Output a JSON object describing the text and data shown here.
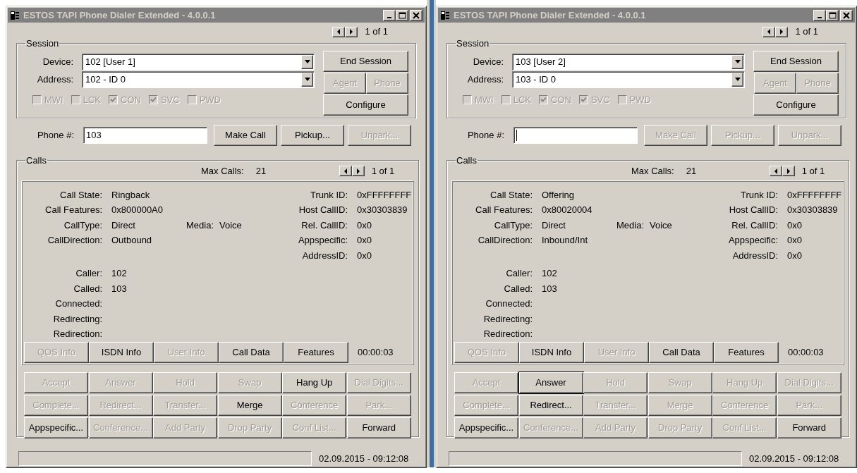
{
  "windows": [
    {
      "title": "ESTOS TAPI Phone Dialer Extended - 4.0.0.1",
      "active": false,
      "pager": "1 of 1",
      "session": {
        "legend": "Session",
        "device": {
          "label": "Device:",
          "value": "102 [User 1]"
        },
        "address": {
          "label": "Address:",
          "value": "102 - ID 0"
        },
        "flags": [
          {
            "label": "MWI",
            "checked": false
          },
          {
            "label": "LCK",
            "checked": false
          },
          {
            "label": "CON",
            "checked": true
          },
          {
            "label": "SVC",
            "checked": true
          },
          {
            "label": "PWD",
            "checked": false
          }
        ],
        "buttons": [
          {
            "label": "End Session",
            "kind": "wide",
            "disabled": false
          },
          {
            "label": "Agent",
            "kind": "half",
            "disabled": true
          },
          {
            "label": "Phone",
            "kind": "half",
            "disabled": true
          },
          {
            "label": "Configure",
            "kind": "wide",
            "disabled": false
          }
        ]
      },
      "phone": {
        "label": "Phone #:",
        "value": "103",
        "focused": false,
        "buttons": [
          {
            "label": "Make Call",
            "disabled": false
          },
          {
            "label": "Pickup...",
            "disabled": false
          },
          {
            "label": "Unpark...",
            "disabled": true
          }
        ]
      },
      "calls": {
        "legend": "Calls",
        "max_label": "Max Calls:",
        "max_value": "21",
        "pager": "1 of 1",
        "fields": [
          {
            "label": "Call State:",
            "value": "Ringback"
          },
          {
            "label": "Call Features:",
            "value": "0x800000A0"
          },
          {
            "label": "CallType:",
            "value": "Direct"
          },
          {
            "label": "CallDirection:",
            "value": "Outbound"
          }
        ],
        "media": {
          "label": "Media:",
          "value": "Voice"
        },
        "ids": [
          {
            "label": "Trunk ID:",
            "value": "0xFFFFFFFF"
          },
          {
            "label": "Host CallID:",
            "value": "0x30303839"
          },
          {
            "label": "Rel. CallID:",
            "value": "0x0"
          },
          {
            "label": "Appspecific:",
            "value": "0x0"
          },
          {
            "label": "AddressID:",
            "value": "0x0"
          }
        ],
        "parties": [
          {
            "label": "Caller:",
            "value": "102"
          },
          {
            "label": "Called:",
            "value": "103"
          },
          {
            "label": "Connected:"
          },
          {
            "label": "Redirecting:"
          },
          {
            "label": "Redirection:"
          }
        ],
        "info_buttons": [
          {
            "label": "QOS Info",
            "disabled": true
          },
          {
            "label": "ISDN Info",
            "disabled": false
          },
          {
            "label": "User Info",
            "disabled": true
          },
          {
            "label": "Call Data",
            "disabled": false
          },
          {
            "label": "Features",
            "disabled": false
          }
        ],
        "timer": "00:00:03"
      },
      "actions": [
        {
          "label": "Accept",
          "disabled": true,
          "default": false
        },
        {
          "label": "Answer",
          "disabled": true,
          "default": false
        },
        {
          "label": "Hold",
          "disabled": true,
          "default": false
        },
        {
          "label": "Swap",
          "disabled": true,
          "default": false
        },
        {
          "label": "Hang Up",
          "disabled": false,
          "default": false
        },
        {
          "label": "Dial Digits...",
          "disabled": true,
          "default": false
        },
        {
          "label": "Complete...",
          "disabled": true,
          "default": false
        },
        {
          "label": "Redirect...",
          "disabled": true,
          "default": false
        },
        {
          "label": "Transfer...",
          "disabled": true,
          "default": false
        },
        {
          "label": "Merge",
          "disabled": false,
          "default": false
        },
        {
          "label": "Conference",
          "disabled": true,
          "default": false
        },
        {
          "label": "Park...",
          "disabled": true,
          "default": false
        },
        {
          "label": "Appspecific...",
          "disabled": false,
          "default": false
        },
        {
          "label": "Conference...",
          "disabled": true,
          "default": false
        },
        {
          "label": "Add Party",
          "disabled": true,
          "default": false
        },
        {
          "label": "Drop Party",
          "disabled": true,
          "default": false
        },
        {
          "label": "Conf List...",
          "disabled": true,
          "default": false
        },
        {
          "label": "Forward",
          "disabled": false,
          "default": false
        }
      ],
      "status_time": "02.09.2015 - 09:12:08"
    },
    {
      "title": "ESTOS TAPI Phone Dialer Extended - 4.0.0.1",
      "active": false,
      "pager": "1 of 1",
      "session": {
        "legend": "Session",
        "device": {
          "label": "Device:",
          "value": "103 [User 2]"
        },
        "address": {
          "label": "Address:",
          "value": "103 - ID 0"
        },
        "flags": [
          {
            "label": "MWI",
            "checked": false
          },
          {
            "label": "LCK",
            "checked": false
          },
          {
            "label": "CON",
            "checked": true
          },
          {
            "label": "SVC",
            "checked": true
          },
          {
            "label": "PWD",
            "checked": false
          }
        ],
        "buttons": [
          {
            "label": "End Session",
            "kind": "wide",
            "disabled": false
          },
          {
            "label": "Agent",
            "kind": "half",
            "disabled": true
          },
          {
            "label": "Phone",
            "kind": "half",
            "disabled": true
          },
          {
            "label": "Configure",
            "kind": "wide",
            "disabled": false
          }
        ]
      },
      "phone": {
        "label": "Phone #:",
        "focused": true,
        "buttons": [
          {
            "label": "Make Call",
            "disabled": true
          },
          {
            "label": "Pickup...",
            "disabled": true
          },
          {
            "label": "Unpark...",
            "disabled": true
          }
        ]
      },
      "calls": {
        "legend": "Calls",
        "max_label": "Max Calls:",
        "max_value": "21",
        "pager": "1 of 1",
        "fields": [
          {
            "label": "Call State:",
            "value": "Offering"
          },
          {
            "label": "Call Features:",
            "value": "0x80020004"
          },
          {
            "label": "CallType:",
            "value": "Direct"
          },
          {
            "label": "CallDirection:",
            "value": "Inbound/Int"
          }
        ],
        "media": {
          "label": "Media:",
          "value": "Voice"
        },
        "ids": [
          {
            "label": "Trunk ID:",
            "value": "0xFFFFFFFF"
          },
          {
            "label": "Host CallID:",
            "value": "0x30303839"
          },
          {
            "label": "Rel. CallID:",
            "value": "0x0"
          },
          {
            "label": "Appspecific:",
            "value": "0x0"
          },
          {
            "label": "AddressID:",
            "value": "0x0"
          }
        ],
        "parties": [
          {
            "label": "Caller:",
            "value": "102"
          },
          {
            "label": "Called:",
            "value": "103"
          },
          {
            "label": "Connected:"
          },
          {
            "label": "Redirecting:"
          },
          {
            "label": "Redirection:"
          }
        ],
        "info_buttons": [
          {
            "label": "QOS Info",
            "disabled": true
          },
          {
            "label": "ISDN Info",
            "disabled": false
          },
          {
            "label": "User Info",
            "disabled": true
          },
          {
            "label": "Call Data",
            "disabled": false
          },
          {
            "label": "Features",
            "disabled": false
          }
        ],
        "timer": "00:00:03"
      },
      "actions": [
        {
          "label": "Accept",
          "disabled": true,
          "default": false
        },
        {
          "label": "Answer",
          "disabled": false,
          "default": true
        },
        {
          "label": "Hold",
          "disabled": true,
          "default": false
        },
        {
          "label": "Swap",
          "disabled": true,
          "default": false
        },
        {
          "label": "Hang Up",
          "disabled": true,
          "default": false
        },
        {
          "label": "Dial Digits...",
          "disabled": true,
          "default": false
        },
        {
          "label": "Complete...",
          "disabled": true,
          "default": false
        },
        {
          "label": "Redirect...",
          "disabled": false,
          "default": false
        },
        {
          "label": "Transfer...",
          "disabled": true,
          "default": false
        },
        {
          "label": "Merge",
          "disabled": true,
          "default": false
        },
        {
          "label": "Conference",
          "disabled": true,
          "default": false
        },
        {
          "label": "Park...",
          "disabled": true,
          "default": false
        },
        {
          "label": "Appspecific...",
          "disabled": false,
          "default": false
        },
        {
          "label": "Conference...",
          "disabled": true,
          "default": false
        },
        {
          "label": "Add Party",
          "disabled": true,
          "default": false
        },
        {
          "label": "Drop Party",
          "disabled": true,
          "default": false
        },
        {
          "label": "Conf List...",
          "disabled": true,
          "default": false
        },
        {
          "label": "Forward",
          "disabled": false,
          "default": false
        }
      ],
      "status_time": "02.09.2015 - 09:12:08"
    }
  ]
}
